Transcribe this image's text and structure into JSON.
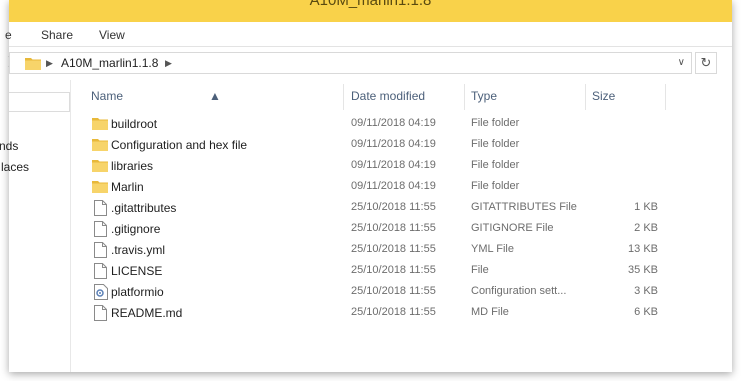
{
  "window": {
    "title": "A10M_marlin1.1.8"
  },
  "ribbon": {
    "tabs": [
      "e",
      "Share",
      "View"
    ]
  },
  "address_bar": {
    "crumb": "A10M_marlin1.1.8"
  },
  "nav_pane": {
    "items": [
      "nds",
      "laces"
    ]
  },
  "columns": {
    "name": "Name",
    "date_modified": "Date modified",
    "type": "Type",
    "size": "Size"
  },
  "files": [
    {
      "name": "buildroot",
      "date": "09/11/2018 04:19",
      "type": "File folder",
      "size": "",
      "icon": "folder-icon"
    },
    {
      "name": "Configuration and hex file",
      "date": "09/11/2018 04:19",
      "type": "File folder",
      "size": "",
      "icon": "folder-icon"
    },
    {
      "name": "libraries",
      "date": "09/11/2018 04:19",
      "type": "File folder",
      "size": "",
      "icon": "folder-icon"
    },
    {
      "name": "Marlin",
      "date": "09/11/2018 04:19",
      "type": "File folder",
      "size": "",
      "icon": "folder-icon"
    },
    {
      "name": ".gitattributes",
      "date": "25/10/2018 11:55",
      "type": "GITATTRIBUTES File",
      "size": "1 KB",
      "icon": "file-icon"
    },
    {
      "name": ".gitignore",
      "date": "25/10/2018 11:55",
      "type": "GITIGNORE File",
      "size": "2 KB",
      "icon": "file-icon"
    },
    {
      "name": ".travis.yml",
      "date": "25/10/2018 11:55",
      "type": "YML File",
      "size": "13 KB",
      "icon": "file-icon"
    },
    {
      "name": "LICENSE",
      "date": "25/10/2018 11:55",
      "type": "File",
      "size": "35 KB",
      "icon": "file-icon"
    },
    {
      "name": "platformio",
      "date": "25/10/2018 11:55",
      "type": "Configuration sett...",
      "size": "3 KB",
      "icon": "settings-file-icon"
    },
    {
      "name": "README.md",
      "date": "25/10/2018 11:55",
      "type": "MD File",
      "size": "6 KB",
      "icon": "file-icon"
    }
  ]
}
